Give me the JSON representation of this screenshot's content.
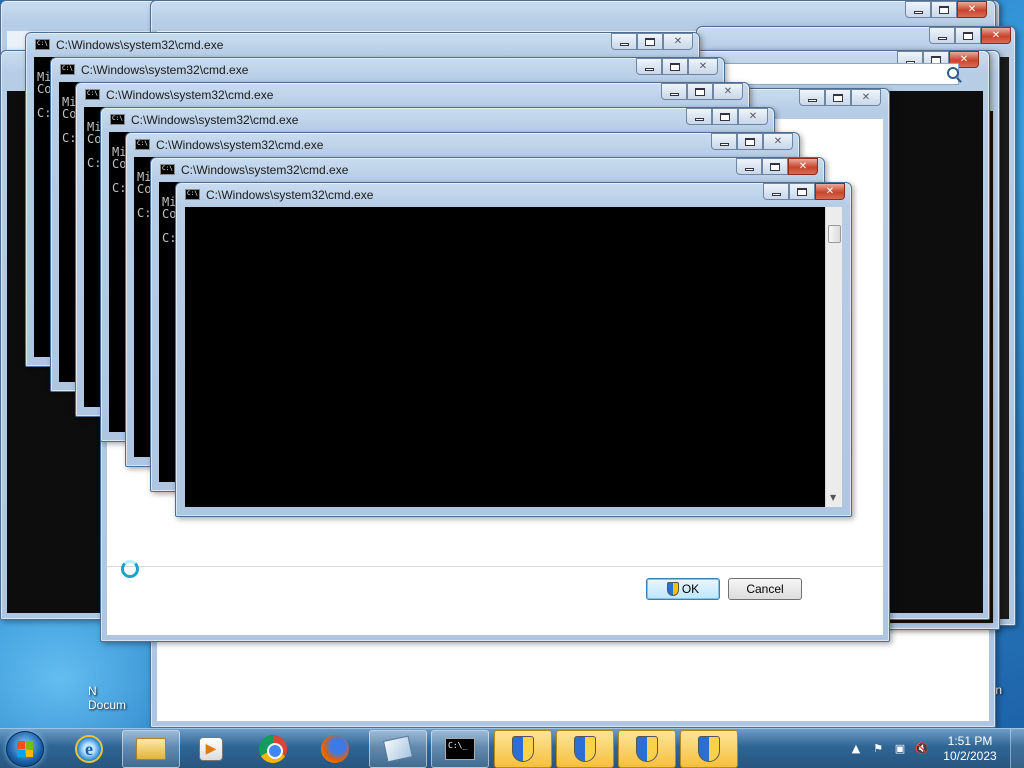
{
  "window_title": "C:\\Windows\\system32\\cmd.exe",
  "console_lines": [
    "Mi",
    "Co",
    "",
    "C:"
  ],
  "dialog": {
    "ok_label": "OK",
    "cancel_label": "Cancel"
  },
  "desktop": {
    "documents_label_fragment": "N\nDocum",
    "recycle_label_fragment": "cle Bin"
  },
  "taskbar": {
    "pinned": [
      "internet-explorer",
      "windows-explorer",
      "windows-media-player",
      "google-chrome",
      "firefox",
      "sticky-notes",
      "command-prompt",
      "uac-prompt",
      "uac-prompt",
      "uac-prompt",
      "uac-prompt"
    ],
    "clock_time": "1:51 PM",
    "clock_date": "10/2/2023"
  },
  "colors": {
    "desktop": "#2c86cc",
    "titlebar": "#c9dcef",
    "close_button": "#c8452f",
    "console_bg": "#000000"
  }
}
